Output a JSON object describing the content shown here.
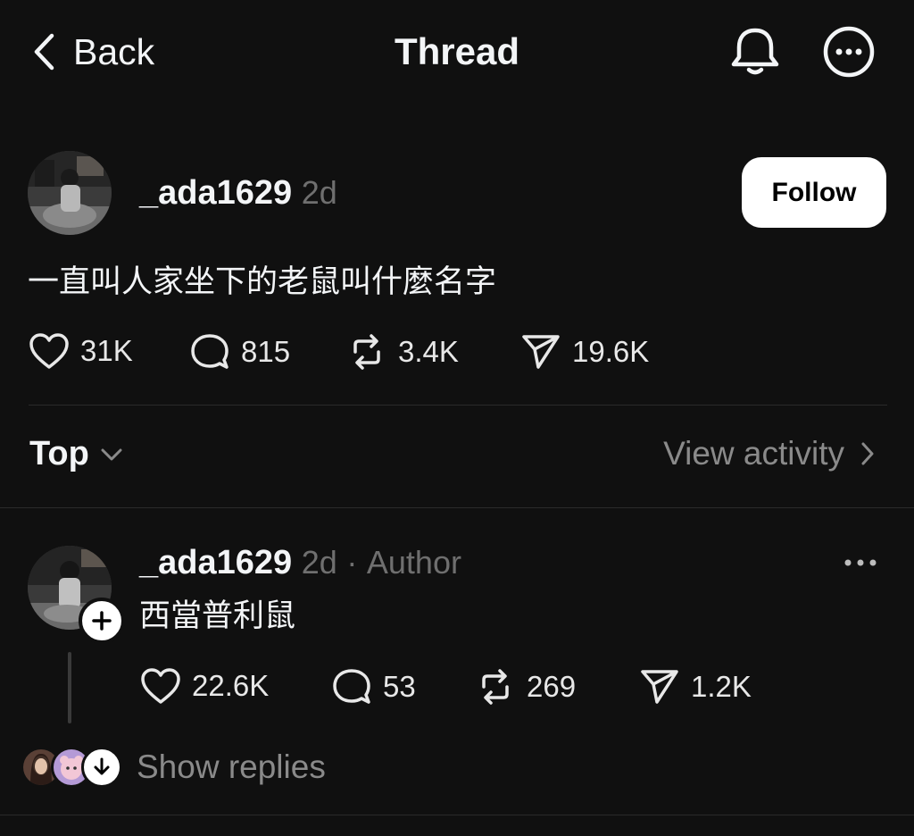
{
  "header": {
    "back_label": "Back",
    "title": "Thread",
    "icons": [
      "chevron-left-icon",
      "bell-icon",
      "more-icon"
    ]
  },
  "post": {
    "username": "_ada1629",
    "time": "2d",
    "follow_label": "Follow",
    "text": "一直叫人家坐下的老鼠叫什麼名字",
    "likes": "31K",
    "comments": "815",
    "reposts": "3.4K",
    "shares": "19.6K"
  },
  "sort": {
    "label": "Top",
    "view_activity_label": "View activity"
  },
  "reply": {
    "username": "_ada1629",
    "time": "2d",
    "separator": "·",
    "badge": "Author",
    "text": "西當普利鼠",
    "likes": "22.6K",
    "comments": "53",
    "reposts": "269",
    "shares": "1.2K",
    "show_replies_label": "Show replies"
  },
  "colors": {
    "background": "#101010",
    "text": "#f3f5f7",
    "muted": "#6f6f6f",
    "follow_bg": "#ffffff",
    "divider": "#2a2a2a"
  }
}
